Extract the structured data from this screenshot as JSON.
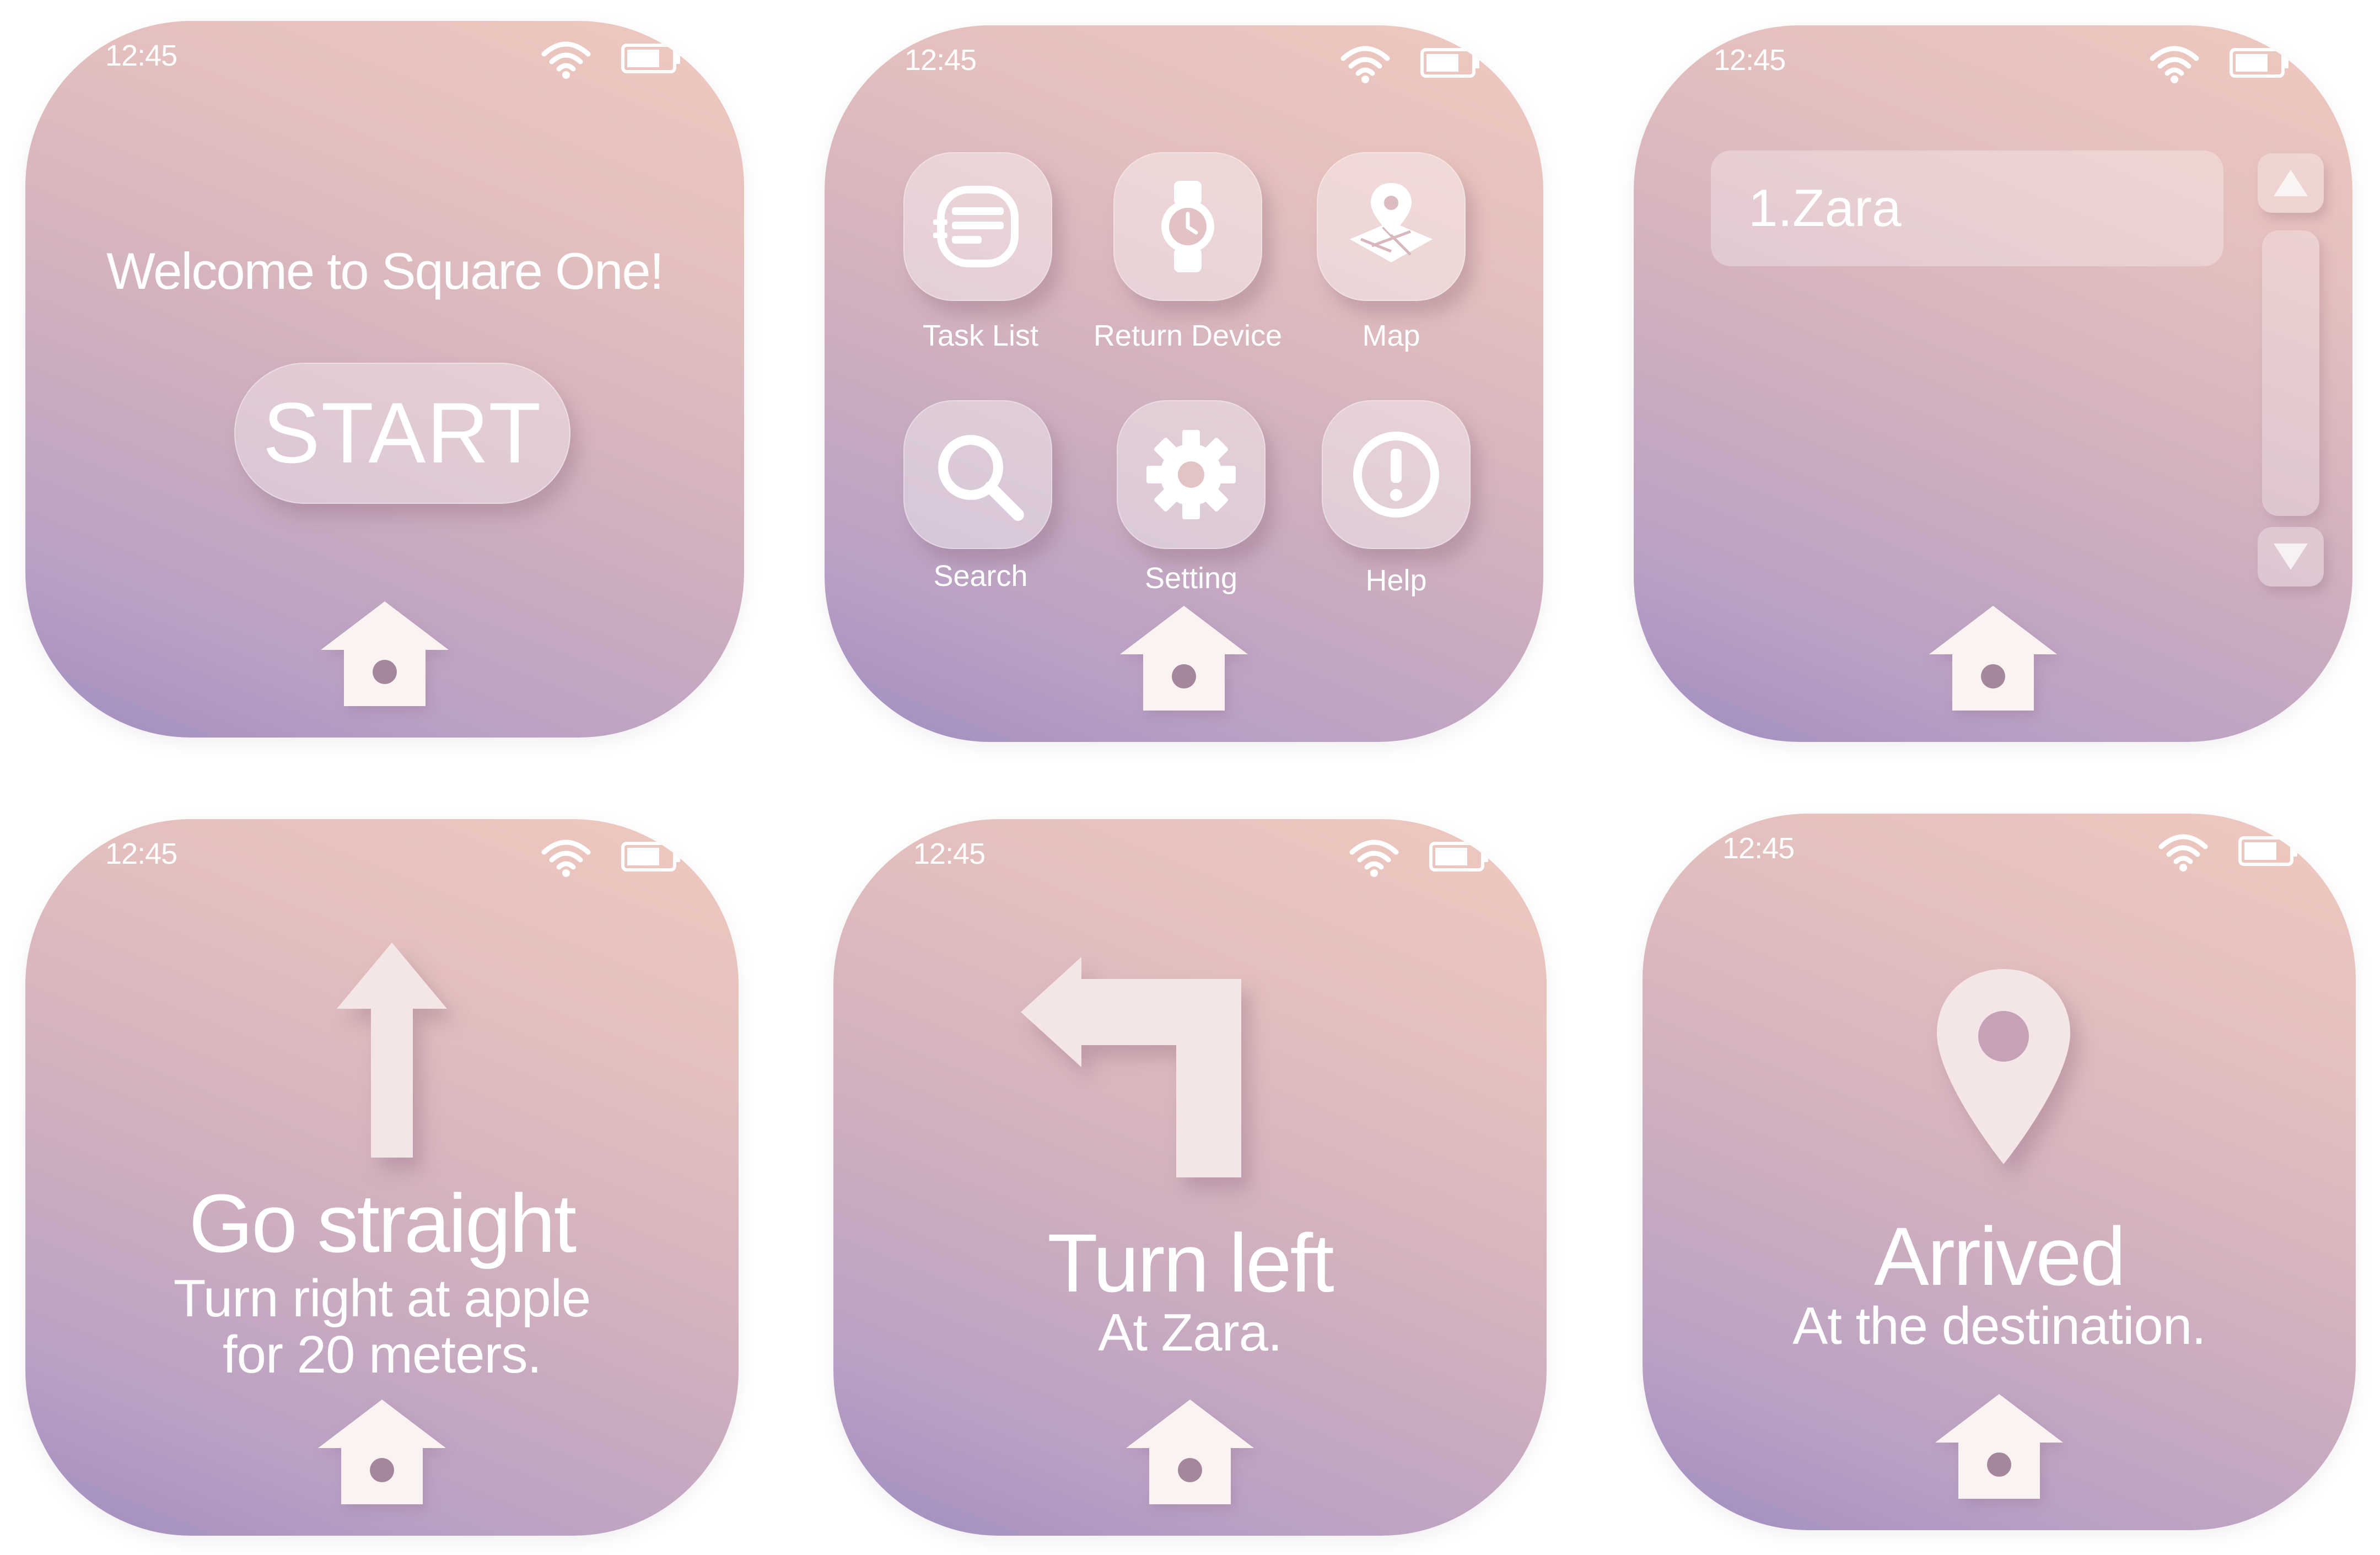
{
  "status_bar": {
    "time": "12:45",
    "wifi_icon": "wifi-icon",
    "battery_icon": "battery-icon"
  },
  "welcome_screen": {
    "greeting": "Welcome to Square One!",
    "start_label": "START"
  },
  "menu_screen": {
    "items": [
      {
        "label": "Task List",
        "icon": "task-list-icon"
      },
      {
        "label": "Return Device",
        "icon": "watch-icon"
      },
      {
        "label": "Map",
        "icon": "map-icon"
      },
      {
        "label": "Search",
        "icon": "search-icon"
      },
      {
        "label": "Setting",
        "icon": "gear-icon"
      },
      {
        "label": "Help",
        "icon": "alert-icon"
      }
    ]
  },
  "task_list_screen": {
    "items": [
      "1.Zara"
    ]
  },
  "straight_screen": {
    "title": "Go straight",
    "subtitle_line1": "Turn right at apple",
    "subtitle_line2": "for 20 meters."
  },
  "left_screen": {
    "title": "Turn left",
    "subtitle": "At Zara."
  },
  "arrived_screen": {
    "title": "Arrived",
    "subtitle": "At the destination."
  },
  "colors": {
    "gradient_start": "#a18cbf",
    "gradient_end": "#efc9bf",
    "foreground": "#ffffff"
  }
}
